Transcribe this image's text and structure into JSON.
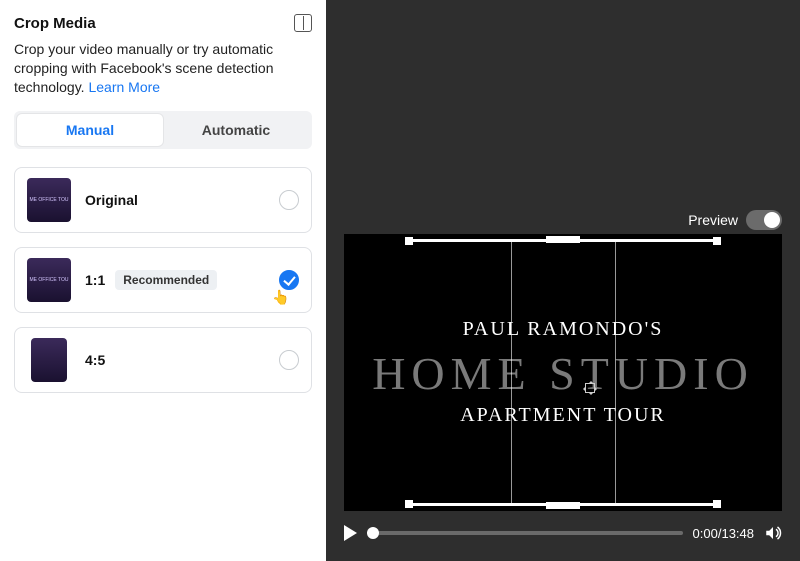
{
  "header": {
    "title": "Crop Media"
  },
  "description": "Crop your video manually or try automatic cropping with Facebook's scene detection technology. ",
  "learn_more": "Learn More",
  "tabs": {
    "manual": "Manual",
    "automatic": "Automatic"
  },
  "options": [
    {
      "label": "Original",
      "thumb_text": "ME OFFICE TOU",
      "narrow": false
    },
    {
      "label": "1:1",
      "badge": "Recommended",
      "thumb_text": "ME OFFICE TOU",
      "narrow": false,
      "selected": true
    },
    {
      "label": "4:5",
      "thumb_text": "",
      "narrow": true
    }
  ],
  "preview": {
    "label": "Preview"
  },
  "video_text": {
    "line1": "PAUL RAMONDO'S",
    "line2": "HOME STUDIO",
    "line3": "APARTMENT TOUR"
  },
  "player": {
    "time": "0:00/13:48"
  }
}
